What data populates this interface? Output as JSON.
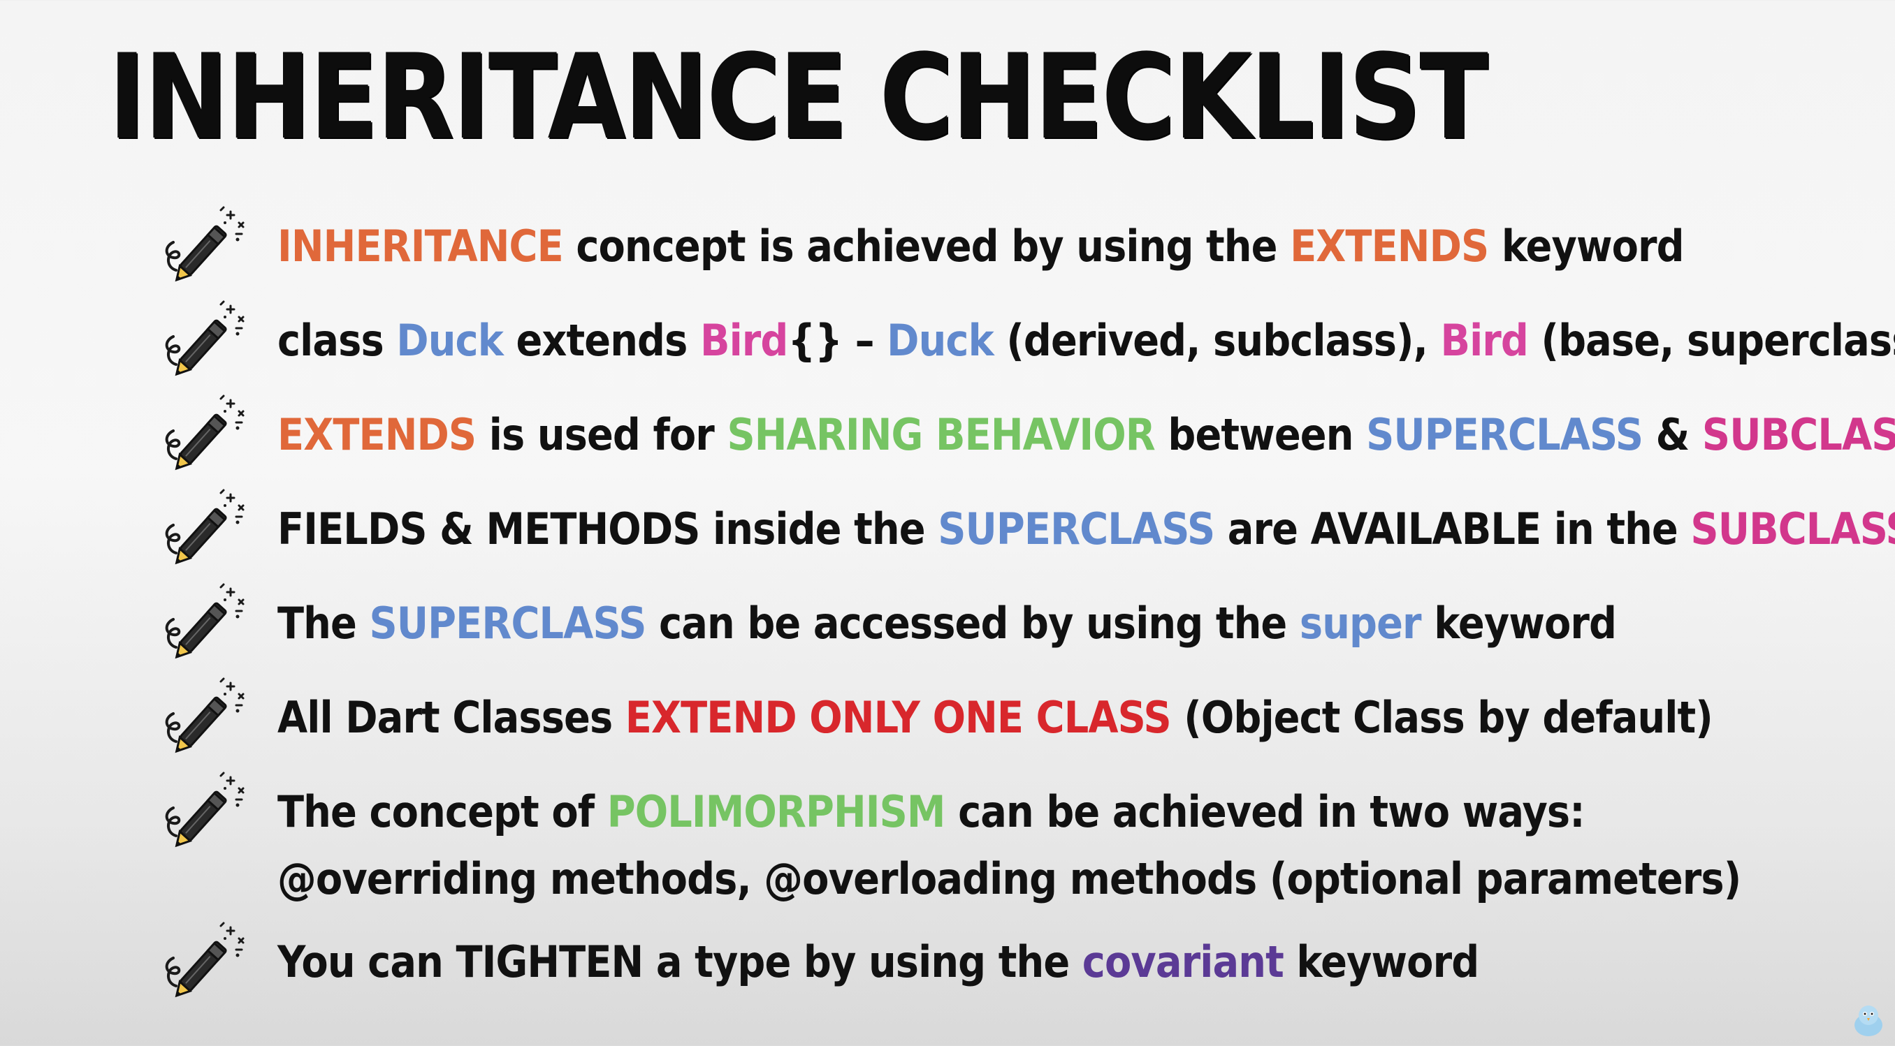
{
  "title": "INHERITANCE CHECKLIST",
  "icon_name": "magic-wand-pencil-icon",
  "colors": {
    "orange": "#e0683a",
    "blue": "#6189cd",
    "pink": "#d6449e",
    "green": "#76c463",
    "red": "#d8272c",
    "purple": "#5b3a95",
    "text": "#111111"
  },
  "items": [
    {
      "s0": "INHERITANCE",
      "s1": " concept is achieved by using the ",
      "s2": "EXTENDS",
      "s3": " keyword"
    },
    {
      "s0": "class ",
      "s1": "Duck",
      "s2": " extends ",
      "s3": "Bird",
      "s4": "{} – ",
      "s5": "Duck",
      "s6": " (derived, subclass), ",
      "s7": "Bird",
      "s8": " (base, superclass)"
    },
    {
      "s0": "EXTENDS",
      "s1": " is used for ",
      "s2": "SHARING BEHAVIOR",
      "s3": " between ",
      "s4": "SUPERCLASS",
      "s5": " & ",
      "s6": "SUBCLASS"
    },
    {
      "s0": "FIELDS & METHODS inside the ",
      "s1": "SUPERCLASS",
      "s2": " are AVAILABLE in the ",
      "s3": "SUBCLASS"
    },
    {
      "s0": "The ",
      "s1": "SUPERCLASS",
      "s2": " can be accessed by using the ",
      "s3": "super",
      "s4": " keyword"
    },
    {
      "s0": "All Dart Classes ",
      "s1": "EXTEND ONLY ONE CLASS",
      "s2": " (Object Class by default)"
    },
    {
      "s0": "The concept of ",
      "s1": "POLIMORPHISM",
      "s2": " can be achieved in two ways:",
      "line2": "@overriding methods, @overloading methods (optional parameters)"
    },
    {
      "s0": "You can TIGHTEN a type by using the ",
      "s1": "covariant",
      "s2": " keyword"
    }
  ]
}
